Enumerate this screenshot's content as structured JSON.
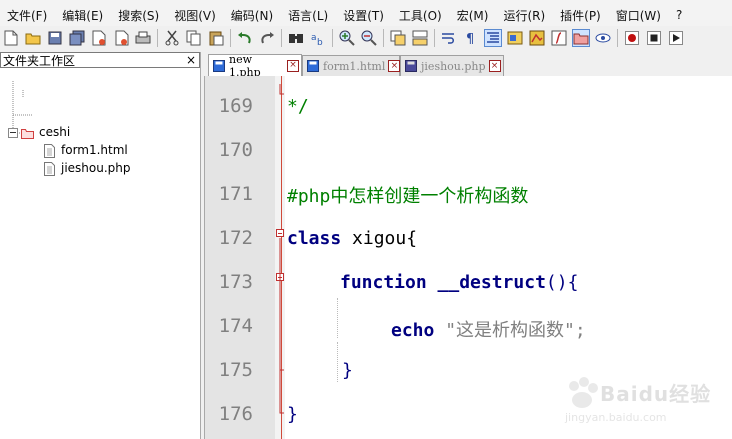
{
  "menu": {
    "items": [
      "文件(F)",
      "编辑(E)",
      "搜索(S)",
      "视图(V)",
      "编码(N)",
      "语言(L)",
      "设置(T)",
      "工具(O)",
      "宏(M)",
      "运行(R)",
      "插件(P)",
      "窗口(W)",
      "?"
    ]
  },
  "toolbar": {
    "icons": [
      "new-file-icon",
      "open-file-icon",
      "save-icon",
      "save-all-icon",
      "close-icon",
      "close-all-icon",
      "print-icon",
      "cut-icon",
      "copy-icon",
      "paste-icon",
      "undo-icon",
      "redo-icon",
      "find-icon",
      "replace-icon",
      "zoom-in-icon",
      "zoom-out-icon",
      "sync-vertical-icon",
      "sync-horizontal-icon",
      "word-wrap-icon",
      "show-all-chars-icon",
      "indent-guide-icon",
      "lang-define-icon",
      "doc-map-icon",
      "function-list-icon",
      "folder-workspace-icon",
      "monitor-icon",
      "record-macro-icon",
      "stop-macro-icon",
      "play-macro-icon"
    ]
  },
  "sidebar": {
    "title": "文件夹工作区",
    "close_label": "×",
    "root": "ceshi",
    "files": [
      "form1.html",
      "jieshou.php"
    ]
  },
  "tabs": [
    {
      "label": "new 1.php",
      "active": true,
      "color": "#2e6bd8"
    },
    {
      "label": "form1.html",
      "active": false,
      "color": "#2e6bd8"
    },
    {
      "label": "jieshou.php",
      "active": false,
      "color": "#4a4a9a"
    }
  ],
  "editor": {
    "lines": [
      {
        "num": "169",
        "text": "*/"
      },
      {
        "num": "170",
        "text": ""
      },
      {
        "num": "171",
        "text": "#php中怎样创建一个析构函数"
      },
      {
        "num": "172",
        "kw": "class",
        "rest": " xigou{"
      },
      {
        "num": "173",
        "kw": "function",
        "rest": " __destruct(){",
        "kw2": "__destruct"
      },
      {
        "num": "174",
        "kw": "echo",
        "str": " \"这是析构函数\";"
      },
      {
        "num": "175",
        "text": "}"
      },
      {
        "num": "176",
        "text": "}"
      }
    ]
  },
  "watermark": {
    "brand": "Baidu经验",
    "url": "jingyan.baidu.com"
  }
}
